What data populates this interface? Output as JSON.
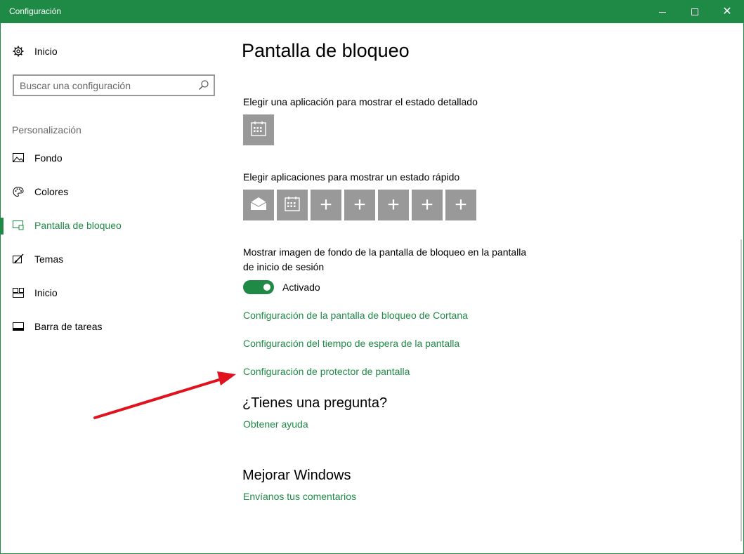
{
  "window": {
    "title": "Configuración"
  },
  "sidebar": {
    "home_label": "Inicio",
    "search_placeholder": "Buscar una configuración",
    "group_label": "Personalización",
    "items": [
      {
        "label": "Fondo",
        "icon": "picture-icon"
      },
      {
        "label": "Colores",
        "icon": "palette-icon"
      },
      {
        "label": "Pantalla de bloqueo",
        "icon": "lock-screen-icon",
        "selected": true
      },
      {
        "label": "Temas",
        "icon": "themes-icon"
      },
      {
        "label": "Inicio",
        "icon": "start-icon"
      },
      {
        "label": "Barra de tareas",
        "icon": "taskbar-icon"
      }
    ]
  },
  "main": {
    "title": "Pantalla de bloqueo",
    "detailed_status_label": "Elegir una aplicación para mostrar el estado detallado",
    "quick_status_label": "Elegir aplicaciones para mostrar un estado rápido",
    "quick_status_tiles": [
      "mail-icon",
      "calendar-icon",
      "plus-icon",
      "plus-icon",
      "plus-icon",
      "plus-icon",
      "plus-icon"
    ],
    "signin_bg_label_line1": "Mostrar imagen de fondo de la pantalla de bloqueo en la pantalla",
    "signin_bg_label_line2": "de inicio de sesión",
    "toggle_state": "Activado",
    "link_cortana": "Configuración de la pantalla de bloqueo de Cortana",
    "link_timeout": "Configuración del tiempo de espera de la pantalla",
    "link_screensaver": "Configuración de protector de pantalla",
    "question_heading": "¿Tienes una pregunta?",
    "help_link": "Obtener ayuda",
    "improve_heading": "Mejorar Windows",
    "feedback_link": "Envíanos tus comentarios"
  },
  "colors": {
    "accent": "#1f8a46",
    "tile": "#999999",
    "annotation_arrow": "#e0121d"
  }
}
